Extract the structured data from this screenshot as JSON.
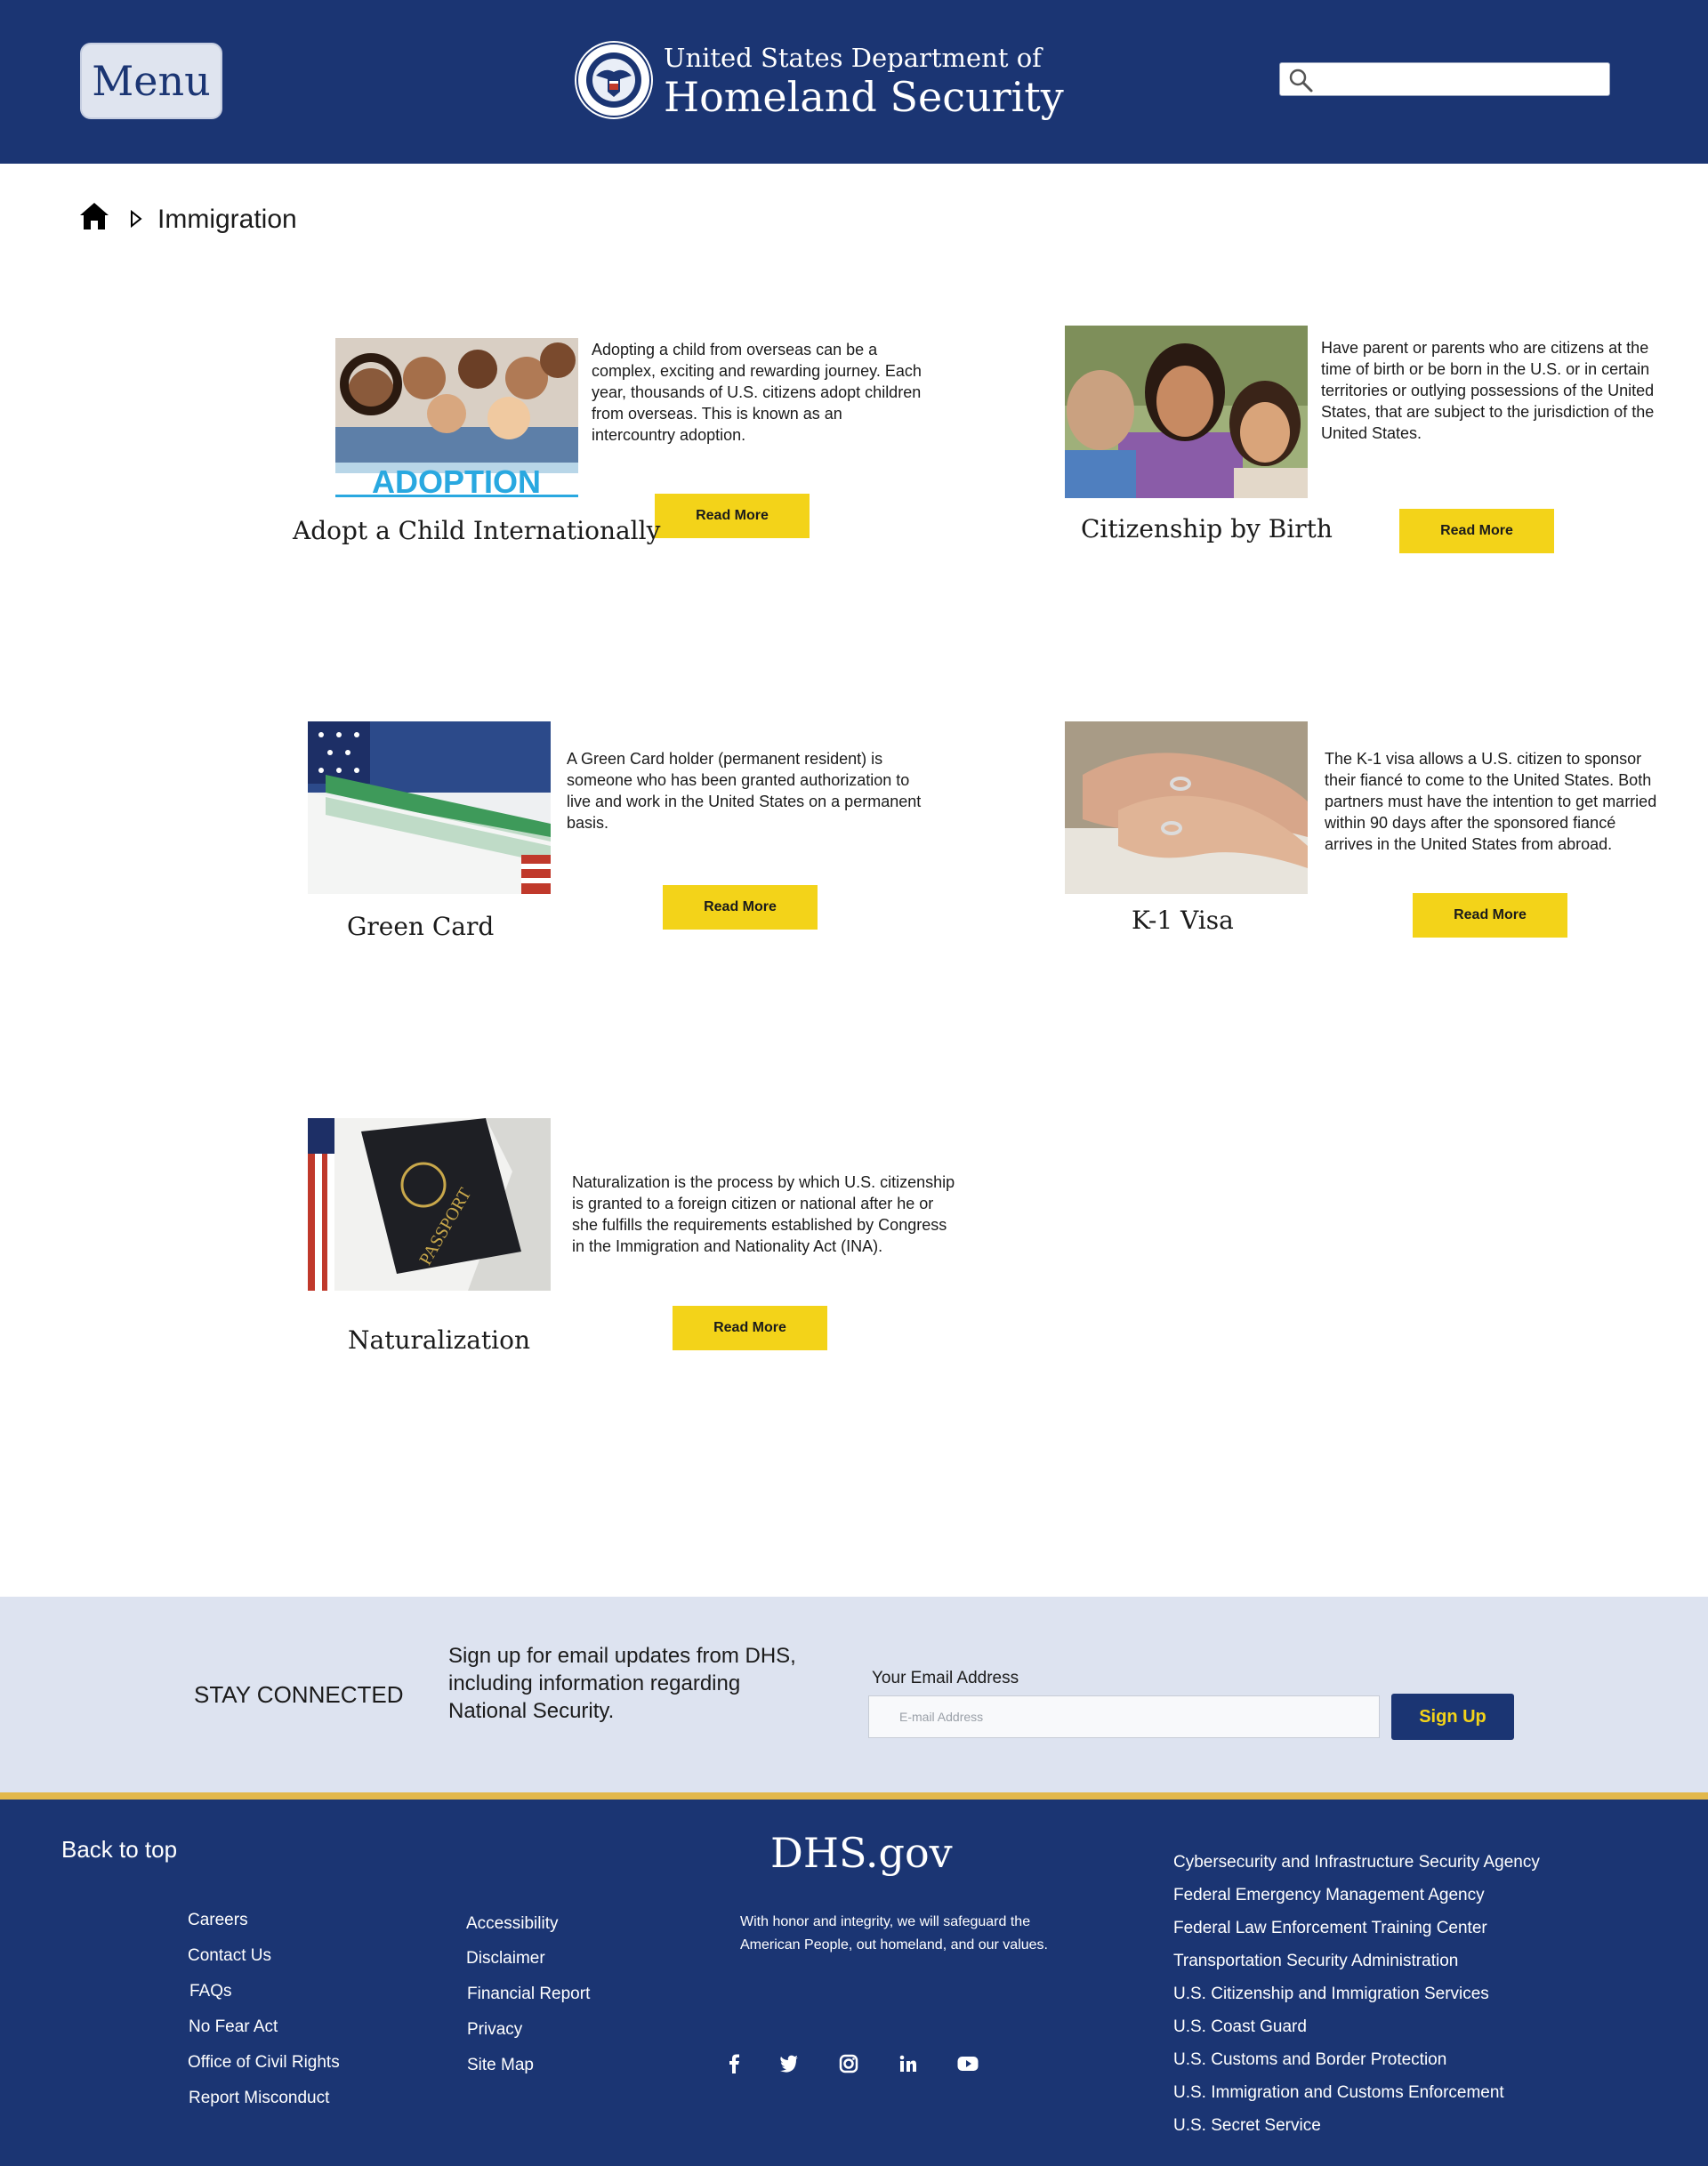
{
  "header": {
    "menu_label": "Menu",
    "dept_line1": "United States Department of",
    "dept_line2": "Homeland Security",
    "search_placeholder": "",
    "seal_icon": "dhs-seal-icon",
    "search_icon": "search-icon"
  },
  "breadcrumb": {
    "home_icon": "home-icon",
    "current": "Immigration"
  },
  "cards": [
    {
      "title": "Adopt a Child Internationally",
      "description": "Adopting a child from overseas can be a complex, exciting and rewarding journey. Each year, thousands of U.S. citizens adopt children from overseas. This is known as an intercountry adoption.",
      "button": "Read More",
      "image_caption": "ADOPTION"
    },
    {
      "title": "Citizenship by Birth",
      "description": "Have parent or parents who are citizens at the time of birth or be born in the U.S. or in certain territories or outlying possessions of the United States, that are subject to the jurisdiction of the United States.",
      "button": "Read More"
    },
    {
      "title": "Green Card",
      "description": "A Green Card holder (permanent resident) is someone who has been granted authorization to live and work in the United States on a permanent basis.",
      "button": "Read More"
    },
    {
      "title": "K-1 Visa",
      "description": "The K-1 visa allows a U.S. citizen to sponsor their fiancé to come to the United States. Both partners must have the intention to get married within 90 days after the sponsored fiancé arrives in the United States from abroad.",
      "button": "Read More"
    },
    {
      "title": "Naturalization",
      "description": "Naturalization is the process by which U.S. citizenship is granted to a foreign citizen or national after he or she fulfills the requirements established by Congress in the Immigration and Nationality Act (INA).",
      "button": "Read More"
    }
  ],
  "stay_connected": {
    "title": "STAY CONNECTED",
    "description": "Sign up for email updates from DHS, including information regarding National Security.",
    "email_label": "Your Email Address",
    "email_placeholder": "E-mail Address",
    "button": "Sign Up"
  },
  "footer": {
    "back_to_top": "Back to top",
    "site_name": "DHS.gov",
    "tagline": "With honor and integrity, we will safeguard the American People, out homeland, and our values.",
    "links_col1": [
      "Careers",
      "Contact Us",
      "FAQs",
      "No Fear Act",
      "Office of Civil Rights",
      "Report Misconduct"
    ],
    "links_col2": [
      "Accessibility",
      "Disclaimer",
      "Financial Report",
      "Privacy",
      "Site Map"
    ],
    "agencies": [
      "Cybersecurity and Infrastructure Security Agency",
      "Federal Emergency Management Agency",
      "Federal Law Enforcement Training Center",
      "Transportation Security Administration",
      "U.S. Citizenship and Immigration Services",
      "U.S. Coast Guard",
      "U.S. Customs and Border Protection",
      "U.S. Immigration and Customs Enforcement",
      "U.S. Secret Service"
    ],
    "social_icons": [
      "facebook-icon",
      "twitter-icon",
      "instagram-icon",
      "linkedin-icon",
      "youtube-icon"
    ]
  },
  "colors": {
    "navy": "#1b3573",
    "gold_button": "#f3d319",
    "stripe_gold": "#e2b84b",
    "stay_bg": "#dde3f0"
  }
}
